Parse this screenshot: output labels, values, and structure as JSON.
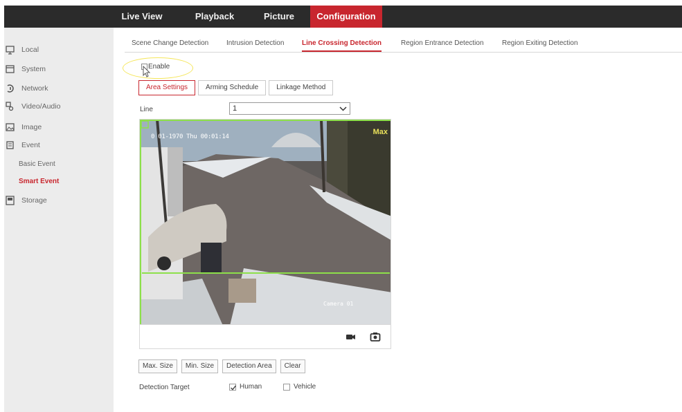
{
  "top_nav": {
    "items": [
      {
        "label": "Live View",
        "active": false
      },
      {
        "label": "Playback",
        "active": false
      },
      {
        "label": "Picture",
        "active": false
      },
      {
        "label": "Configuration",
        "active": true
      }
    ]
  },
  "sidebar": {
    "items": [
      {
        "label": "Local",
        "icon": "monitor-icon"
      },
      {
        "label": "System",
        "icon": "system-icon"
      },
      {
        "label": "Network",
        "icon": "network-icon"
      },
      {
        "label": "Video/Audio",
        "icon": "video-audio-icon"
      },
      {
        "label": "Image",
        "icon": "image-icon"
      },
      {
        "label": "Event",
        "icon": "event-icon"
      }
    ],
    "sub_items": [
      {
        "label": "Basic Event",
        "active": false
      },
      {
        "label": "Smart Event",
        "active": true
      }
    ],
    "storage": {
      "label": "Storage",
      "icon": "storage-icon"
    }
  },
  "sub_tabs": [
    {
      "label": "Scene Change Detection",
      "active": false
    },
    {
      "label": "Intrusion Detection",
      "active": false
    },
    {
      "label": "Line Crossing Detection",
      "active": true
    },
    {
      "label": "Region Entrance Detection",
      "active": false
    },
    {
      "label": "Region Exiting Detection",
      "active": false
    }
  ],
  "enable": {
    "label": "Enable",
    "checked": false
  },
  "step_tabs": [
    {
      "label": "Area Settings",
      "active": true
    },
    {
      "label": "Arming Schedule",
      "active": false
    },
    {
      "label": "Linkage Method",
      "active": false
    }
  ],
  "line": {
    "label": "Line",
    "value": "1"
  },
  "video": {
    "osd_time": "0 01-1970 Thu 00:01:14",
    "osd_max": "Max",
    "osd_camera": "Camera 01"
  },
  "buttons": {
    "max_size": "Max. Size",
    "min_size": "Min. Size",
    "detection_area": "Detection Area",
    "clear": "Clear"
  },
  "detection_target": {
    "label": "Detection Target",
    "options": [
      {
        "label": "Human",
        "checked": true
      },
      {
        "label": "Vehicle",
        "checked": false
      }
    ]
  },
  "colors": {
    "accent": "#c8262e",
    "topbar": "#2b2b2b",
    "sidebar": "#ececec",
    "region_line": "#8de04a",
    "highlight": "#f5e65a"
  }
}
